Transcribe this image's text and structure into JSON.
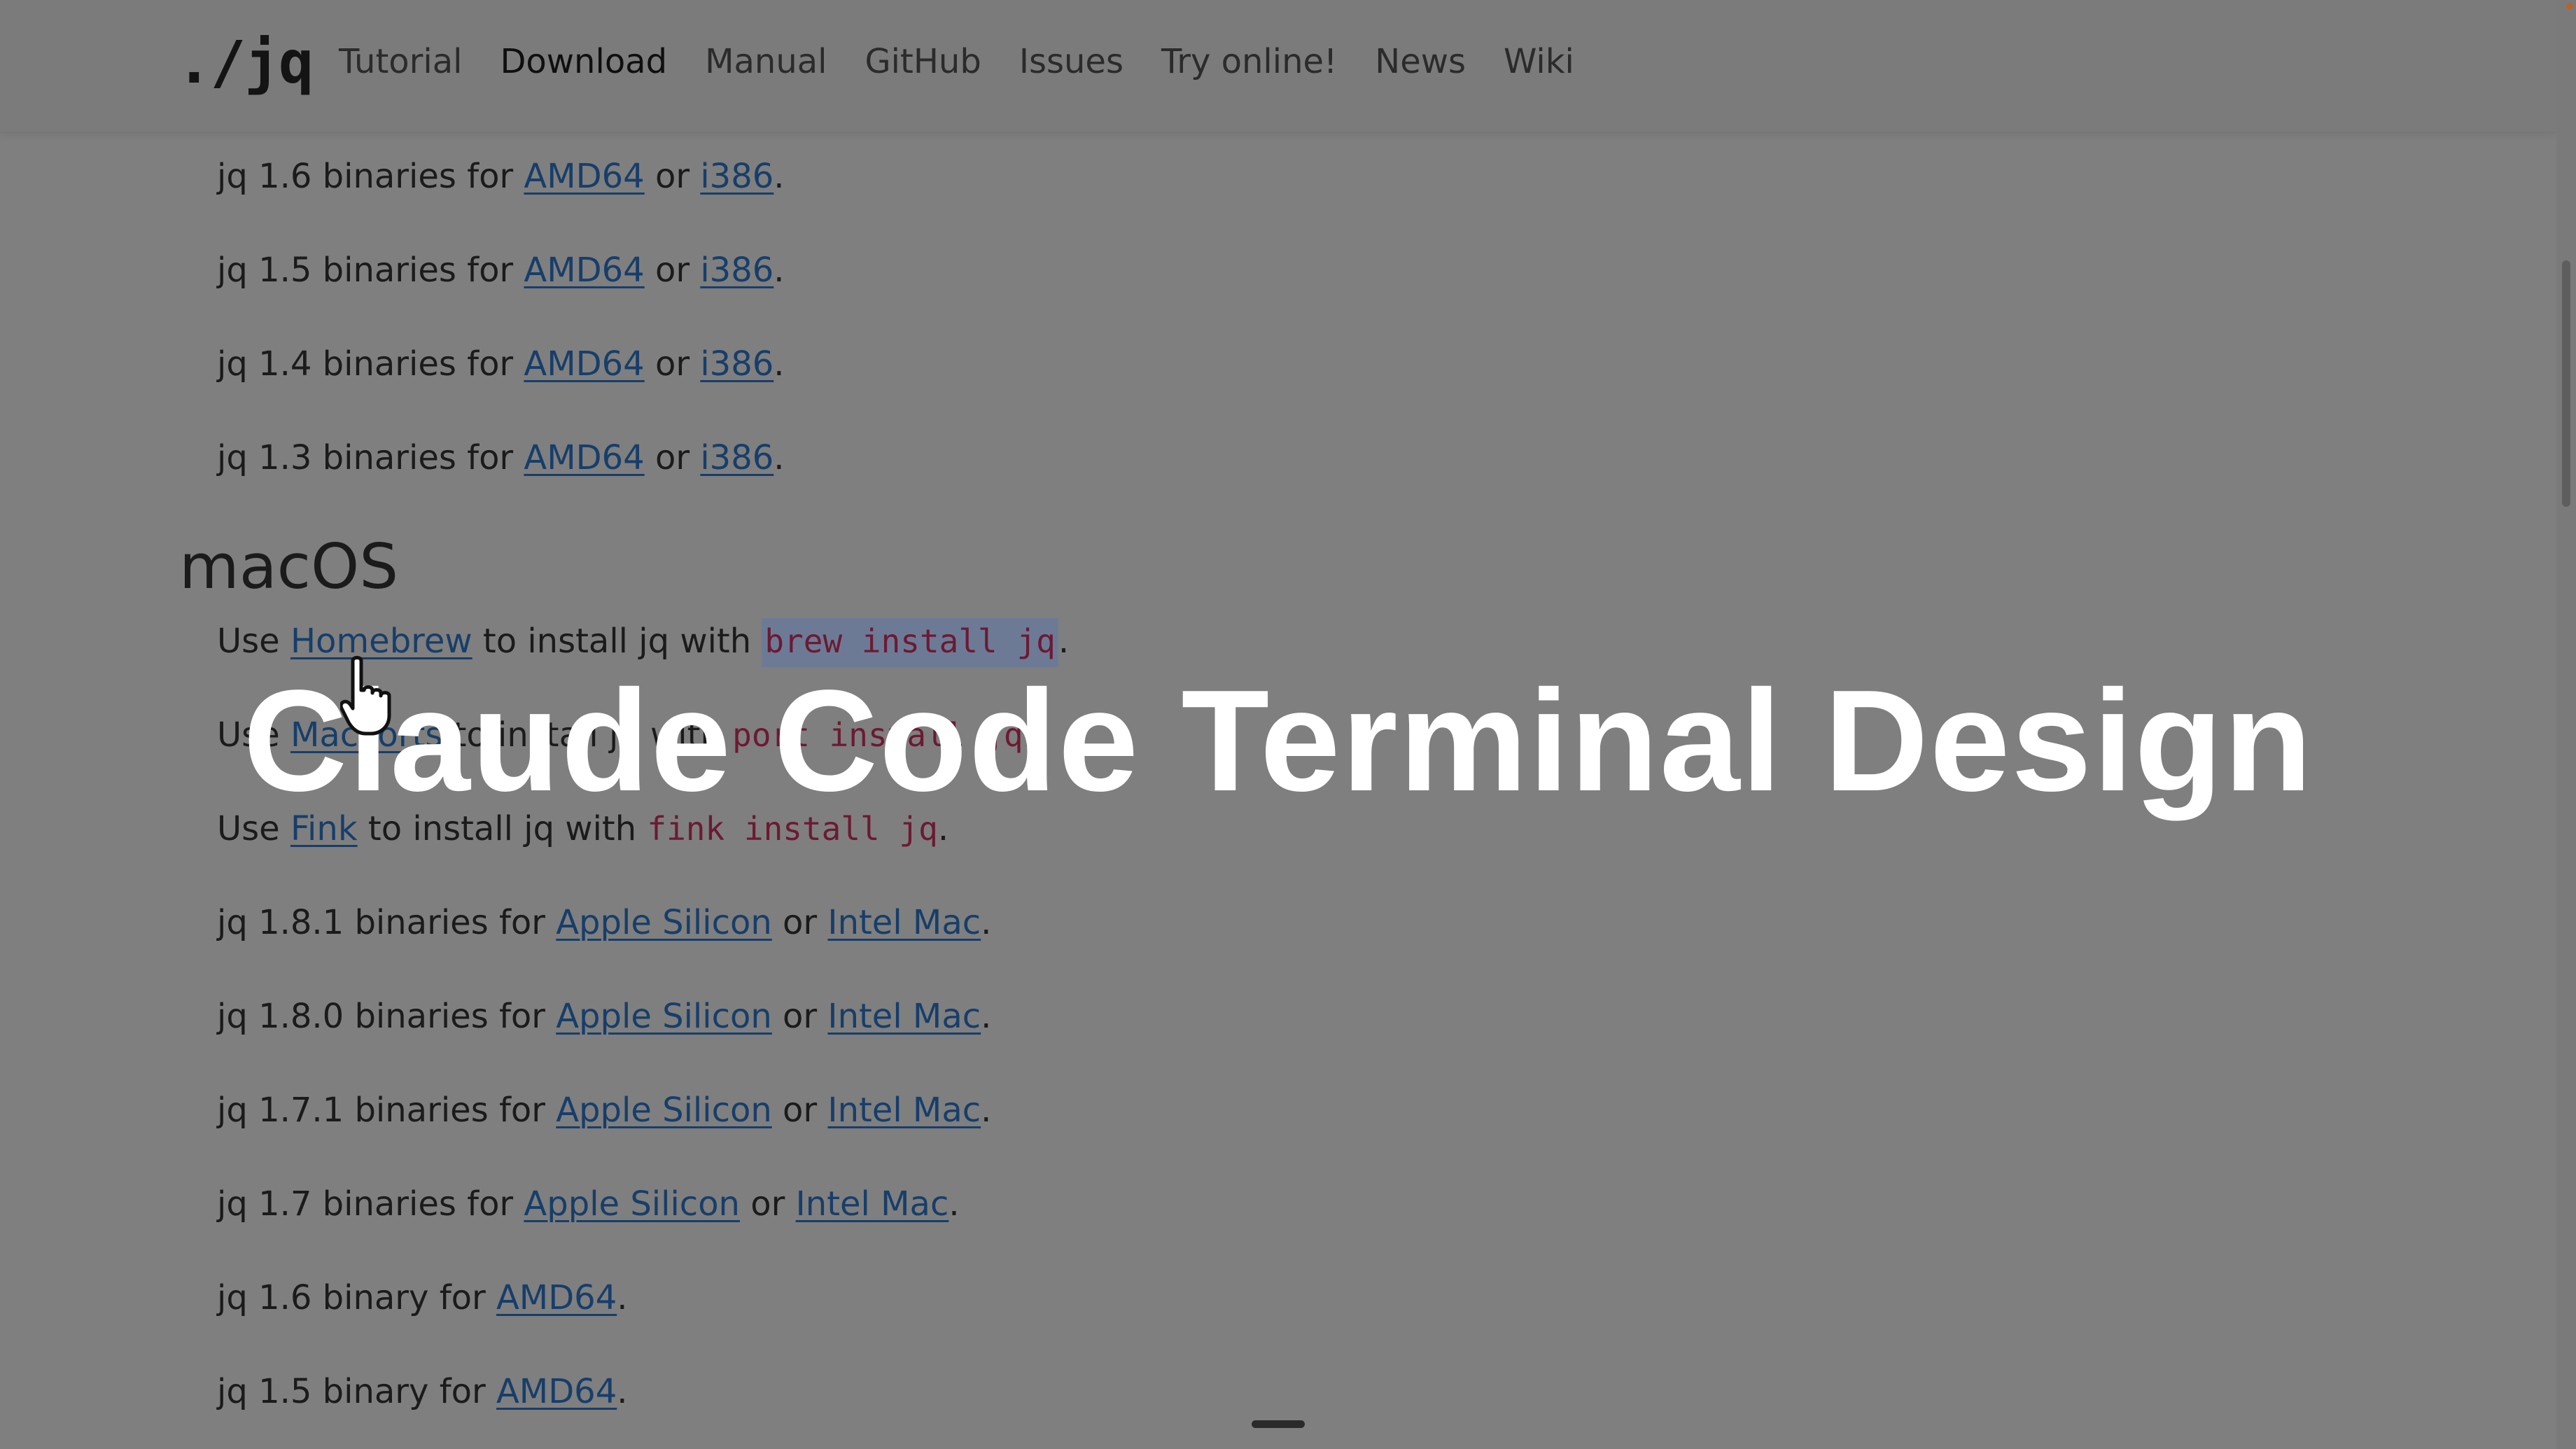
{
  "nav": {
    "brand": "./jq",
    "links": [
      "Tutorial",
      "Download",
      "Manual",
      "GitHub",
      "Issues",
      "Try online!",
      "News",
      "Wiki"
    ],
    "active": "Download"
  },
  "windows_lines": [
    {
      "prefix": "jq 1.6 binaries for ",
      "link1": "AMD64",
      "mid": " or ",
      "link2": "i386",
      "suffix": "."
    },
    {
      "prefix": "jq 1.5 binaries for ",
      "link1": "AMD64",
      "mid": " or ",
      "link2": "i386",
      "suffix": "."
    },
    {
      "prefix": "jq 1.4 binaries for ",
      "link1": "AMD64",
      "mid": " or ",
      "link2": "i386",
      "suffix": "."
    },
    {
      "prefix": "jq 1.3 binaries for ",
      "link1": "AMD64",
      "mid": " or ",
      "link2": "i386",
      "suffix": "."
    }
  ],
  "macos": {
    "heading": "macOS",
    "homebrew": {
      "prefix": "Use ",
      "link": "Homebrew",
      "mid": " to install jq with ",
      "code": "brew install jq",
      "suffix": "."
    },
    "macports": {
      "prefix": "Use ",
      "link": "MacPorts",
      "mid": " to install jq with ",
      "code": "port install jq",
      "suffix": "."
    },
    "fink": {
      "prefix": "Use ",
      "link": "Fink",
      "mid": " to install jq with ",
      "code": "fink install jq",
      "suffix": "."
    },
    "binaries": [
      {
        "prefix": "jq 1.8.1 binaries for ",
        "link1": "Apple Silicon",
        "mid": " or ",
        "link2": "Intel Mac",
        "suffix": "."
      },
      {
        "prefix": "jq 1.8.0 binaries for ",
        "link1": "Apple Silicon",
        "mid": " or ",
        "link2": "Intel Mac",
        "suffix": "."
      },
      {
        "prefix": "jq 1.7.1 binaries for ",
        "link1": "Apple Silicon",
        "mid": " or ",
        "link2": "Intel Mac",
        "suffix": "."
      },
      {
        "prefix": "jq 1.7 binaries for ",
        "link1": "Apple Silicon",
        "mid": " or ",
        "link2": "Intel Mac",
        "suffix": "."
      }
    ],
    "single": [
      {
        "prefix": "jq 1.6 binary for ",
        "link": "AMD64",
        "suffix": "."
      },
      {
        "prefix": "jq 1.5 binary for ",
        "link": "AMD64",
        "suffix": "."
      }
    ]
  },
  "overlay": {
    "title": "Claude Code Terminal Design"
  },
  "colors": {
    "link": "#173e6a",
    "code": "#6b1a32",
    "selection": "#6d7a96",
    "dim_background": "#7f7f7f",
    "overlay_text": "#ffffff"
  }
}
